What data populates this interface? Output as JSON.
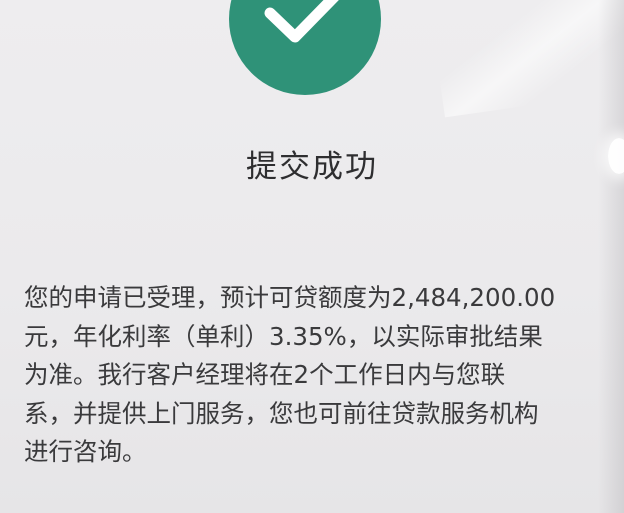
{
  "status": {
    "icon": "check-circle-icon",
    "title": "提交成功"
  },
  "message": {
    "lines": [
      "您的申请已受理，预计可贷额度为2,484,200.00",
      "元，年化利率（单利）3.35%，以实际审批结果",
      "为准。我行客户经理将在2个工作日内与您联",
      "系，并提供上门服务，您也可前往贷款服务机构",
      "进行咨询。"
    ]
  },
  "colors": {
    "success": "#2f9278",
    "background": "#eceaec"
  }
}
